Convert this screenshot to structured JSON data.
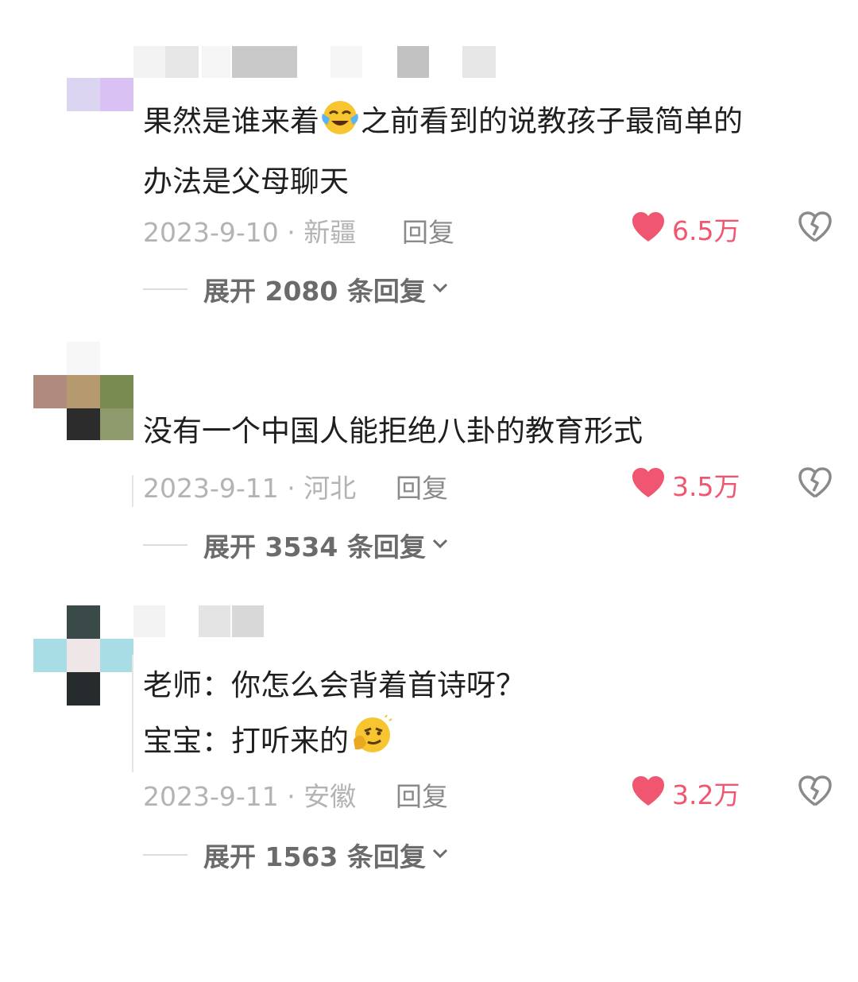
{
  "colors": {
    "like_red": "#f0566f",
    "meta_gray": "#b3b3b3",
    "text_dark": "#1f1f1f"
  },
  "comments": [
    {
      "lines": [
        "果然是谁来着",
        "之前看到的说教孩子最简单的",
        "办法是父母聊天"
      ],
      "emoji": "crying-laughing-emoji",
      "date_location": "2023-9-10 · 新疆",
      "reply_label": "回复",
      "likes": "6.5万",
      "expand_label": "展开 2080 条回复"
    },
    {
      "lines": [
        "没有一个中国人能拒绝八卦的教育形式"
      ],
      "date_location": "2023-9-11 · 河北",
      "reply_label": "回复",
      "likes": "3.5万",
      "expand_label": "展开 3534 条回复"
    },
    {
      "lines": [
        "老师：你怎么会背着首诗呀？",
        "宝宝：打听来的"
      ],
      "emoji": "thinking-smirk-emoji",
      "date_location": "2023-9-11 · 安徽",
      "reply_label": "回复",
      "likes": "3.2万",
      "expand_label": "展开 1563 条回复"
    }
  ],
  "icons": {
    "like": "heart-icon",
    "dislike": "broken-heart-icon",
    "expand": "chevron-down-icon"
  }
}
